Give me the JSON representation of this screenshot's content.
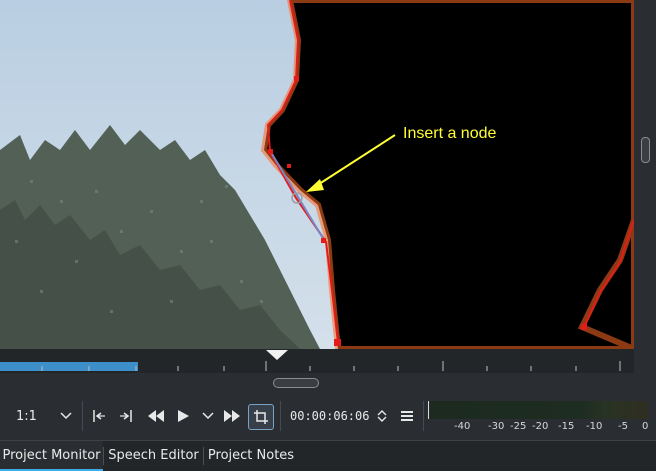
{
  "annotation": {
    "text": "Insert a node"
  },
  "monitor_controls": {
    "zoom_label": "1:1",
    "timecode": "00:00:06:06"
  },
  "audio_meter": {
    "labels": [
      "-40",
      "-30",
      "-25",
      "-20",
      "-15",
      "-10",
      "-5",
      "0"
    ]
  },
  "tabs": [
    {
      "label": "Project Monitor",
      "active": true
    },
    {
      "label": "Speech Editor",
      "active": false
    },
    {
      "label": "Project Notes",
      "active": false
    }
  ],
  "colors": {
    "accent": "#3daee9",
    "spline": "#e41b1b",
    "annotation": "#ffff33",
    "sky": "#c7d8e6",
    "trees": "#4f5a52"
  }
}
